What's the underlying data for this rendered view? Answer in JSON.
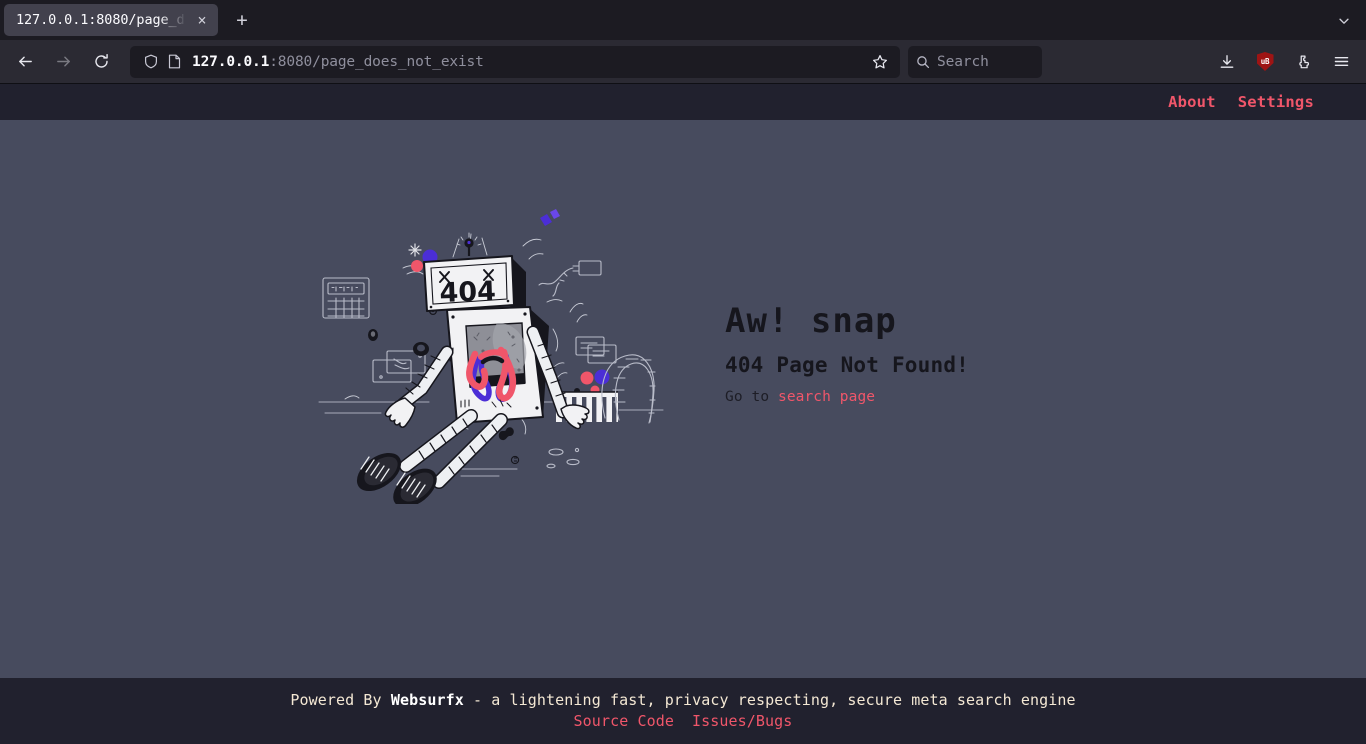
{
  "browser": {
    "tab": {
      "title": "127.0.0.1:8080/page_d",
      "close_label": "×"
    },
    "new_tab_label": "+",
    "toolbar": {
      "back_icon": "back-arrow-icon",
      "forward_icon": "forward-arrow-icon",
      "reload_icon": "reload-icon",
      "shield_icon": "shield-icon",
      "page_icon": "page-document-icon",
      "url_host": "127.0.0.1",
      "url_rest": ":8080/page_does_not_exist",
      "bookmark_icon": "star-icon",
      "search_placeholder": "Search",
      "search_icon": "search-icon",
      "downloads_icon": "download-icon",
      "ublock_label": "uB",
      "ublock_icon": "ublock-origin-shield-icon",
      "extensions_icon": "extensions-puzzle-icon",
      "menu_icon": "hamburger-menu-icon",
      "tablist_icon": "chevron-down-icon"
    }
  },
  "site": {
    "header": {
      "about": "About",
      "settings": "Settings"
    },
    "error": {
      "illustration_name": "broken-robot-404-illustration",
      "robot_screen_text": "404",
      "title": "Aw! snap",
      "subtitle": "404 Page Not Found!",
      "cta_prefix": "Go to ",
      "cta_link": "search page"
    },
    "footer": {
      "powered_prefix": "Powered By ",
      "brand": "Websurfx",
      "tagline": " - a lightening fast, privacy respecting, secure meta search engine",
      "source_code": "Source Code",
      "issues_bugs": "Issues/Bugs"
    }
  },
  "colors": {
    "page_bg": "#474b5e",
    "chrome_bg": "#21212e",
    "accent_pink": "#f0566a",
    "footer_text": "#f4e8d4",
    "heading": "#16161d",
    "browser_chrome": "#2b2a33",
    "browser_tabstrip": "#1c1b22"
  }
}
